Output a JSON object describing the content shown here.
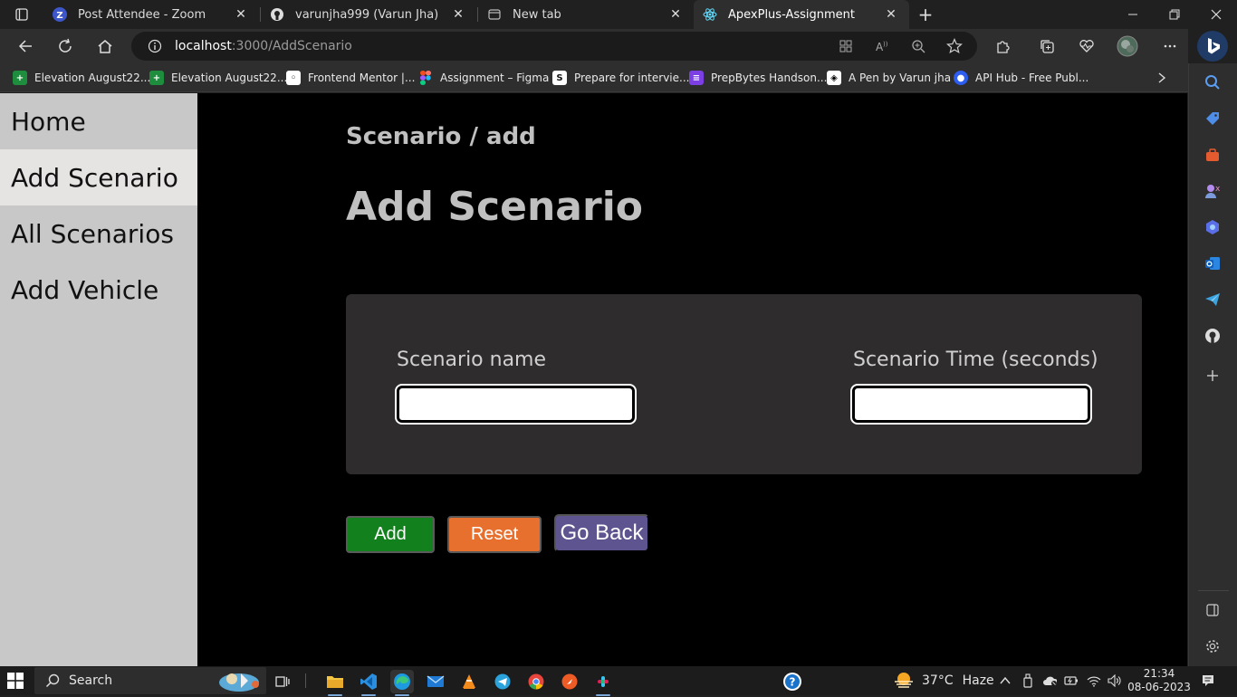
{
  "browser": {
    "tabs": [
      {
        "title": "Post Attendee - Zoom",
        "icon": "zoom-icon"
      },
      {
        "title": "varunjha999 (Varun Jha)",
        "icon": "github-icon"
      },
      {
        "title": "New tab",
        "icon": "newtab-icon"
      },
      {
        "title": "ApexPlus-Assignment",
        "icon": "react-icon",
        "active": true
      }
    ],
    "url_host": "localhost",
    "url_path": ":3000/AddScenario",
    "favorites": [
      {
        "label": "Elevation August22...",
        "icon": "sheets-icon",
        "color": "#1e8e3e"
      },
      {
        "label": "Elevation August22...",
        "icon": "sheets-icon",
        "color": "#1e8e3e"
      },
      {
        "label": "Frontend Mentor |...",
        "icon": "frontend-mentor-icon",
        "color": "#ffffff"
      },
      {
        "label": "Assignment – Figma",
        "icon": "figma-icon",
        "color": "#f24e1e"
      },
      {
        "label": "Prepare for intervie...",
        "icon": "s-icon",
        "color": "#ffffff"
      },
      {
        "label": "PrepBytes Handson...",
        "icon": "prepbytes-icon",
        "color": "#7b3fe4"
      },
      {
        "label": "A Pen by Varun jha",
        "icon": "codepen-icon",
        "color": "#ffffff"
      },
      {
        "label": "API Hub - Free Publ...",
        "icon": "apihub-icon",
        "color": "#2c5cf0"
      }
    ]
  },
  "app": {
    "nav": [
      {
        "label": "Home",
        "active": false
      },
      {
        "label": "Add Scenario",
        "active": true
      },
      {
        "label": "All Scenarios",
        "active": false
      },
      {
        "label": "Add Vehicle",
        "active": false
      }
    ],
    "breadcrumb": "Scenario / add",
    "heading": "Add Scenario",
    "form": {
      "name_label": "Scenario name",
      "name_value": "",
      "time_label": "Scenario Time (seconds)",
      "time_value": ""
    },
    "buttons": {
      "add": "Add",
      "reset": "Reset",
      "back": "Go Back"
    },
    "colors": {
      "add": "#12801d",
      "reset": "#e8702e",
      "back": "#5e5590",
      "sidebar": "#c8c8c8"
    }
  },
  "taskbar": {
    "search_label": "Search",
    "weather_temp": "37°C",
    "weather_text": "Haze",
    "time": "21:34",
    "date": "08-06-2023"
  }
}
